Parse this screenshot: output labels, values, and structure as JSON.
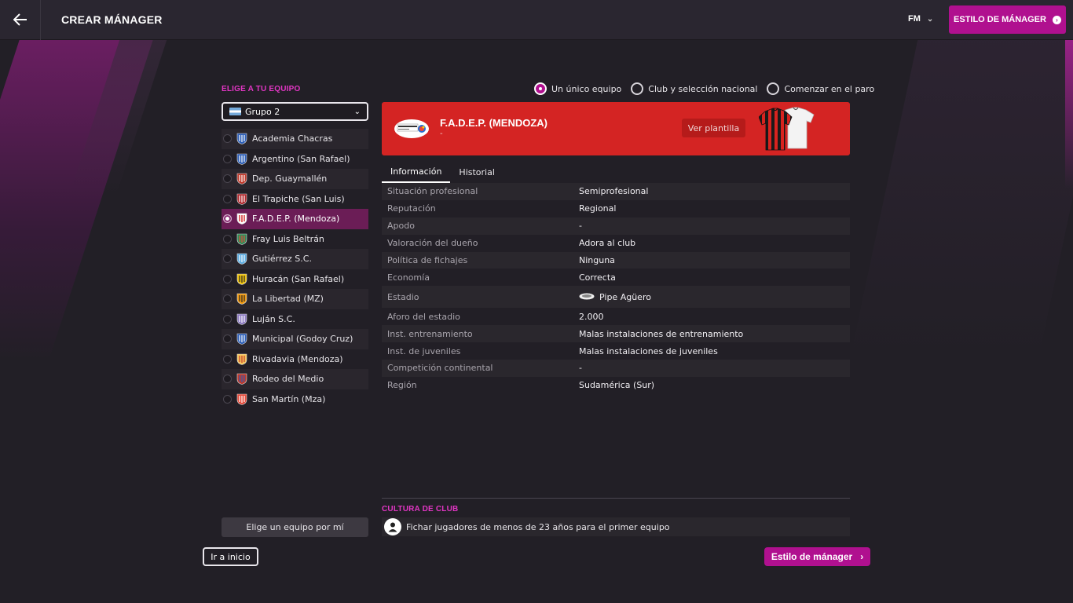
{
  "header": {
    "title": "CREAR MÁNAGER",
    "fm_menu": "FM",
    "style_button": "ESTILO DE MÁNAGER"
  },
  "left_panel": {
    "title": "ELIGE A TU EQUIPO",
    "group_select": "Grupo 2",
    "teams": [
      "Academia Chacras",
      "Argentino (San Rafael)",
      "Dep. Guaymallén",
      "El Trapiche (San Luis)",
      "F.A.D.E.P. (Mendoza)",
      "Fray Luis Beltrán",
      "Gutiérrez S.C.",
      "Huracán (San Rafael)",
      "La Libertad (MZ)",
      "Luján S.C.",
      "Municipal (Godoy Cruz)",
      "Rivadavia (Mendoza)",
      "Rodeo del Medio",
      "San Martín (Mza)"
    ],
    "selected_index": 4,
    "pick_for_me": "Elige un equipo por mí",
    "home_button": "Ir a inicio"
  },
  "mode_options": {
    "single": "Un único equipo",
    "club_national": "Club y selección nacional",
    "unemployed": "Comenzar en el paro"
  },
  "club": {
    "name": "F.A.D.E.P. (MENDOZA)",
    "subtitle": "-",
    "squad_button": "Ver plantilla",
    "color": "#d42423"
  },
  "tabs": [
    "Información",
    "Historial"
  ],
  "info": [
    {
      "key": "Situación profesional",
      "value": "Semiprofesional"
    },
    {
      "key": "Reputación",
      "value": "Regional"
    },
    {
      "key": "Apodo",
      "value": "-"
    },
    {
      "key": "Valoración del dueño",
      "value": "Adora al club"
    },
    {
      "key": "Política de fichajes",
      "value": "Ninguna"
    },
    {
      "key": "Economía",
      "value": "Correcta"
    },
    {
      "key": "Estadio",
      "value": "Pipe Agüero"
    },
    {
      "key": "Aforo del estadio",
      "value": "2.000"
    },
    {
      "key": "Inst. entrenamiento",
      "value": "Malas instalaciones de entrenamiento"
    },
    {
      "key": "Inst. de juveniles",
      "value": "Malas instalaciones de juveniles"
    },
    {
      "key": "Competición continental",
      "value": "-"
    },
    {
      "key": "Región",
      "value": "Sudamérica (Sur)"
    }
  ],
  "culture": {
    "title": "CULTURA DE CLUB",
    "item": "Fichar jugadores de menos de 23 años para el primer equipo"
  },
  "next_button": "Estilo de mánager",
  "colors": {
    "accent": "#b0108f",
    "accent_text": "#e236c4",
    "background": "#221f26"
  }
}
